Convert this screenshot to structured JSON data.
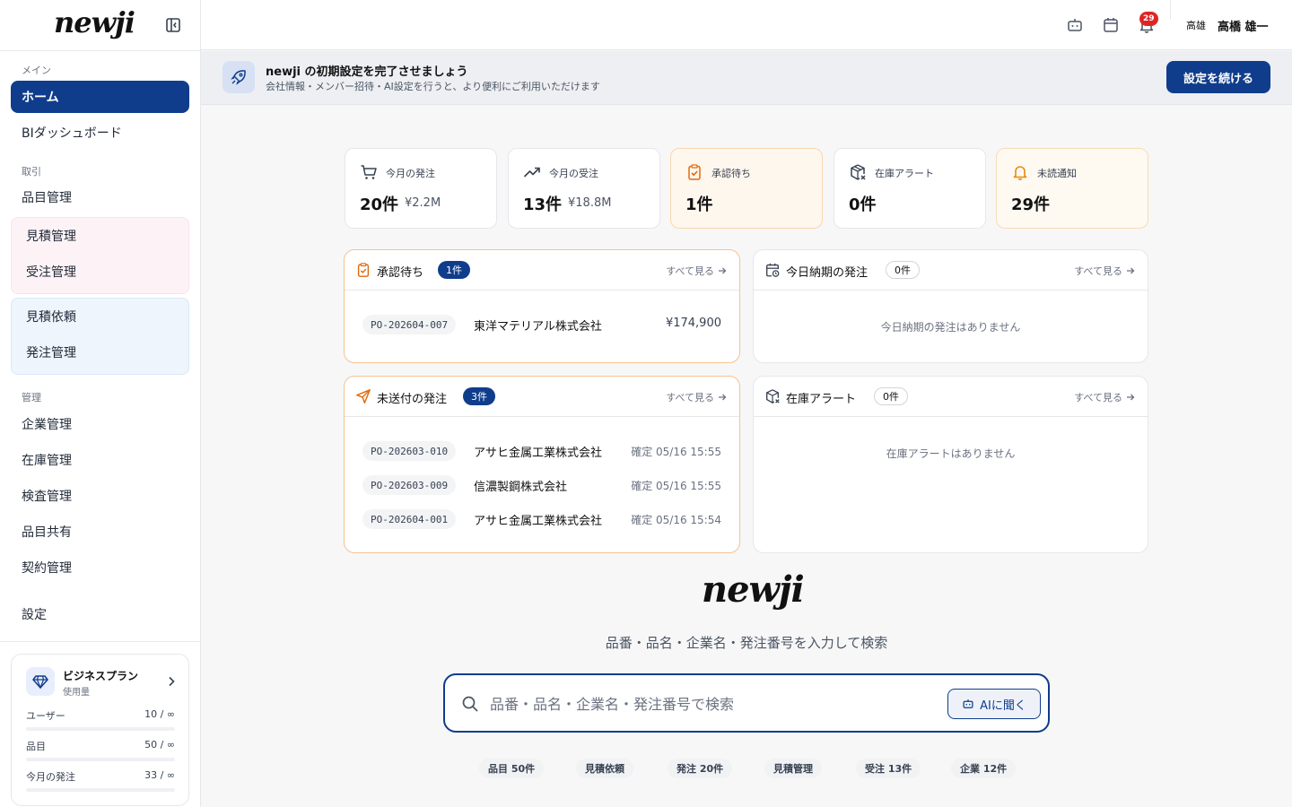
{
  "app": {
    "logo_text": "newji"
  },
  "sidebar": {
    "sections": {
      "main": "メイン",
      "trade": "取引",
      "admin": "管理"
    },
    "items": {
      "home": "ホーム",
      "bi": "BIダッシュボード",
      "items_mgmt": "品目管理",
      "quote_mgmt": "見積管理",
      "order_recv_mgmt": "受注管理",
      "quote_request": "見積依頼",
      "po_mgmt": "発注管理",
      "company_mgmt": "企業管理",
      "inventory_mgmt": "在庫管理",
      "inspection_mgmt": "検査管理",
      "item_share": "品目共有",
      "contract_mgmt": "契約管理",
      "settings": "設定"
    },
    "plan": {
      "title": "ビジネスプラン",
      "subtitle": "使用量",
      "usage": [
        {
          "label": "ユーザー",
          "value": "10 / ∞"
        },
        {
          "label": "品目",
          "value": "50 / ∞"
        },
        {
          "label": "今月の発注",
          "value": "33 / ∞"
        }
      ]
    }
  },
  "topbar": {
    "notification_count": "29",
    "user_short": "高雄",
    "user_name": "高橋 雄一"
  },
  "banner": {
    "title": "newji の初期設定を完了させましょう",
    "subtitle": "会社情報・メンバー招待・AI設定を行うと、より便利にご利用いただけます",
    "button": "設定を続ける"
  },
  "stats": [
    {
      "label": "今月の発注",
      "value": "20件",
      "sub": "¥2.2M"
    },
    {
      "label": "今月の受注",
      "value": "13件",
      "sub": "¥18.8M"
    },
    {
      "label": "承認待ち",
      "value": "1件",
      "sub": ""
    },
    {
      "label": "在庫アラート",
      "value": "0件",
      "sub": ""
    },
    {
      "label": "未読通知",
      "value": "29件",
      "sub": ""
    }
  ],
  "panels": {
    "approval": {
      "title": "承認待ち",
      "count": "1件",
      "see_all": "すべて見る",
      "rows": [
        {
          "code": "PO-202604-007",
          "company": "東洋マテリアル株式会社",
          "right": "¥174,900"
        }
      ]
    },
    "due_today": {
      "title": "今日納期の発注",
      "count": "0件",
      "see_all": "すべて見る",
      "empty": "今日納期の発注はありません"
    },
    "unsent": {
      "title": "未送付の発注",
      "count": "3件",
      "see_all": "すべて見る",
      "rows": [
        {
          "code": "PO-202603-010",
          "company": "アサヒ金属工業株式会社",
          "right": "確定 05/16 15:55"
        },
        {
          "code": "PO-202603-009",
          "company": "信濃製鋼株式会社",
          "right": "確定 05/16 15:55"
        },
        {
          "code": "PO-202604-001",
          "company": "アサヒ金属工業株式会社",
          "right": "確定 05/16 15:54"
        }
      ]
    },
    "inventory": {
      "title": "在庫アラート",
      "count": "0件",
      "see_all": "すべて見る",
      "empty": "在庫アラートはありません"
    }
  },
  "search": {
    "hint": "品番・品名・企業名・発注番号を入力して検索",
    "placeholder": "品番・品名・企業名・発注番号で検索",
    "ai_button": "AIに聞く",
    "chips": [
      "品目 50件",
      "見積依頼",
      "発注 20件",
      "見積管理",
      "受注 13件",
      "企業 12件"
    ]
  },
  "colors": {
    "primary": "#0f3d8c",
    "warning_border": "#f6c28f",
    "badge_red": "#dc2626"
  }
}
